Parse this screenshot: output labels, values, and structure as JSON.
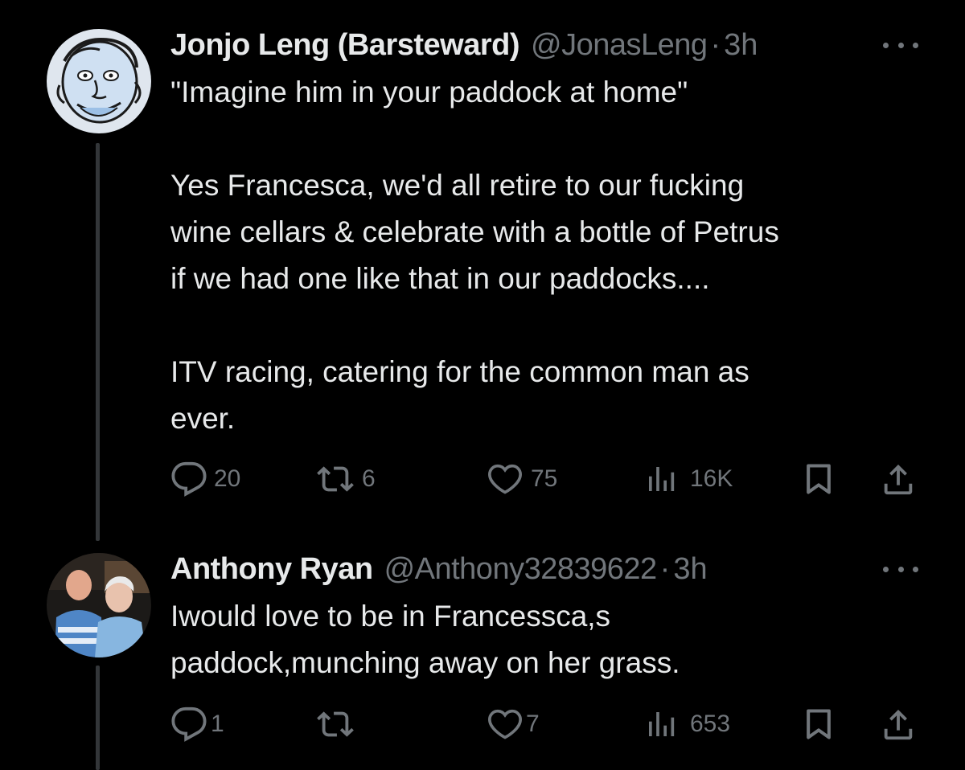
{
  "tweets": [
    {
      "name": "Jonjo Leng (Barsteward)",
      "handle": "@JonasLeng",
      "dot": "·",
      "time": "3h",
      "text": "\"Imagine him in your paddock at home\"\n\nYes Francesca, we'd all retire to our fucking\nwine cellars & celebrate with a bottle of Petrus\nif we had one like that in our paddocks....\n\nITV racing, catering for the common man as\never.",
      "replies": "20",
      "retweets": "6",
      "likes": "75",
      "views": "16K"
    },
    {
      "name": "Anthony Ryan",
      "handle": "@Anthony32839622",
      "dot": "·",
      "time": "3h",
      "text": "Iwould love to be in Francessca,s\npaddock,munching away on her grass.",
      "replies": "1",
      "retweets": "",
      "likes": "7",
      "views": "653"
    }
  ],
  "icons": {
    "reply": "reply-icon",
    "retweet": "retweet-icon",
    "like": "heart-icon",
    "views": "views-icon",
    "bookmark": "bookmark-icon",
    "share": "share-icon",
    "more": "more-icon"
  },
  "colors": {
    "background": "#000000",
    "text": "#e7e9ea",
    "secondary": "#71767b",
    "thread_line": "#333639"
  }
}
